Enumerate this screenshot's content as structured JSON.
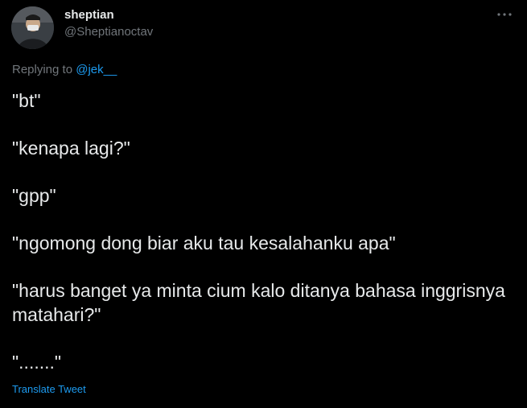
{
  "author": {
    "display_name": "sheptian",
    "handle": "@Sheptianoctav",
    "avatar_icon": "profile-photo"
  },
  "more_icon": "more-horizontal-icon",
  "reply": {
    "prefix": "Replying to",
    "mention": "@jek__"
  },
  "lines": [
    "\"bt\"",
    "\"kenapa lagi?\"",
    "\"gpp\"",
    "\"ngomong dong biar aku tau kesalahanku apa\"",
    "\"harus banget ya minta cium kalo ditanya bahasa inggrisnya matahari?\"",
    "\".......\""
  ],
  "translate_label": "Translate Tweet",
  "colors": {
    "background": "#000000",
    "text": "#e7e9ea",
    "secondary": "#71767b",
    "accent": "#1d9bf0"
  }
}
